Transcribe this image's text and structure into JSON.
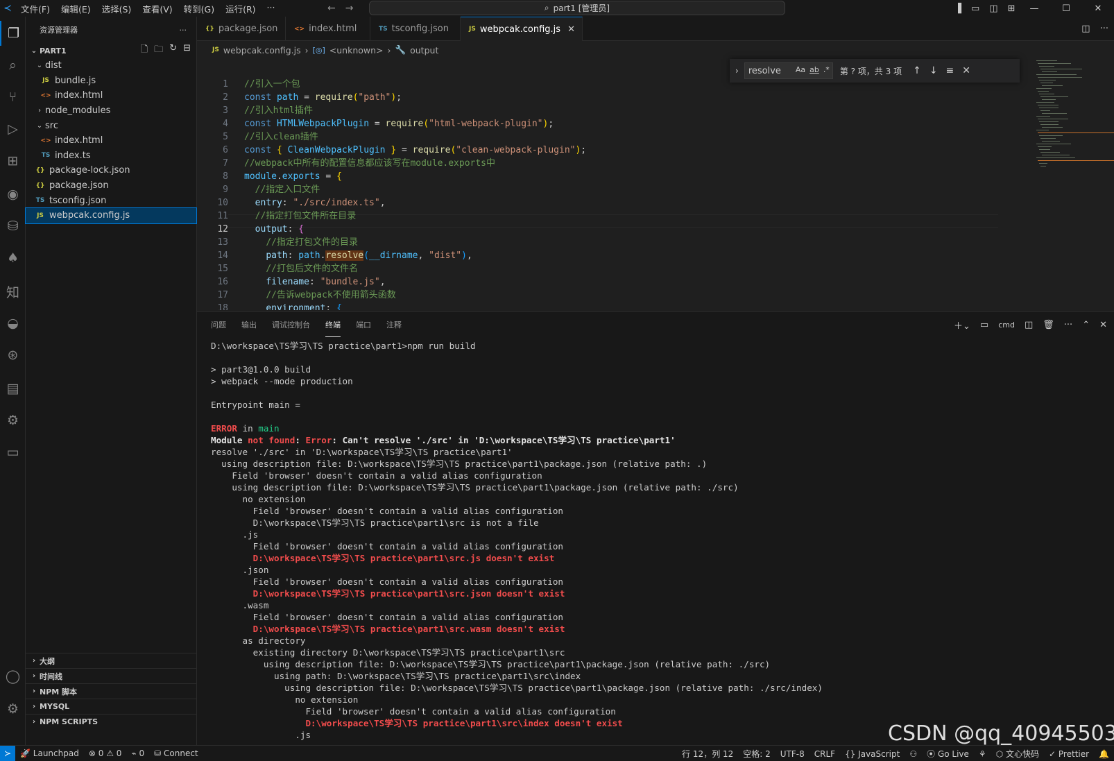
{
  "titlebar": {
    "menus": [
      "文件(F)",
      "编辑(E)",
      "选择(S)",
      "查看(V)",
      "转到(G)",
      "运行(R)",
      "···"
    ],
    "search_text": "part1 [管理员]"
  },
  "sidebar": {
    "title": "资源管理器",
    "more": "···",
    "root": "PART1",
    "tree": [
      {
        "label": "dist",
        "kind": "folder",
        "open": true,
        "depth": 1
      },
      {
        "label": "bundle.js",
        "kind": "js",
        "icon": "JS",
        "depth": 2
      },
      {
        "label": "index.html",
        "kind": "html",
        "icon": "<>",
        "depth": 2
      },
      {
        "label": "node_modules",
        "kind": "folder",
        "open": false,
        "depth": 1
      },
      {
        "label": "src",
        "kind": "folder",
        "open": true,
        "depth": 1
      },
      {
        "label": "index.html",
        "kind": "html",
        "icon": "<>",
        "depth": 2
      },
      {
        "label": "index.ts",
        "kind": "ts",
        "icon": "TS",
        "depth": 2
      },
      {
        "label": "package-lock.json",
        "kind": "json",
        "icon": "{}",
        "depth": 1
      },
      {
        "label": "package.json",
        "kind": "json",
        "icon": "{}",
        "depth": 1
      },
      {
        "label": "tsconfig.json",
        "kind": "ts",
        "icon": "TS",
        "depth": 1
      },
      {
        "label": "webpcak.config.js",
        "kind": "js",
        "icon": "JS",
        "depth": 1,
        "selected": true
      }
    ],
    "sections": [
      "大纲",
      "时间线",
      "NPM 脚本",
      "MYSQL",
      "NPM SCRIPTS"
    ]
  },
  "tabs": [
    {
      "label": "package.json",
      "icon": "{}",
      "kind": "json"
    },
    {
      "label": "index.html",
      "icon": "<>",
      "kind": "html"
    },
    {
      "label": "tsconfig.json",
      "icon": "TS",
      "kind": "ts"
    },
    {
      "label": "webpcak.config.js",
      "icon": "JS",
      "kind": "js",
      "active": true
    }
  ],
  "breadcrumb": [
    "webpcak.config.js",
    "<unknown>",
    "output"
  ],
  "find": {
    "query": "resolve",
    "options": [
      "Aa",
      "ab",
      ".*"
    ],
    "count": "第 ? 项，共 3 项"
  },
  "editor": {
    "line_numbers": [
      "1",
      "2",
      "3",
      "4",
      "5",
      "6",
      "7",
      "8",
      "9",
      "10",
      "11",
      "12",
      "13",
      "14",
      "15",
      "16",
      "17",
      "18"
    ],
    "current_line": "12"
  },
  "panel": {
    "tabs": [
      "问题",
      "输出",
      "调试控制台",
      "终端",
      "端口",
      "注释"
    ],
    "active_tab": "终端",
    "terminal_name": "cmd"
  },
  "terminal": {
    "prompt": "D:\\workspace\\TS学习\\TS practice\\part1>npm run build",
    "lines": [
      "> part3@1.0.0 build",
      "> webpack --mode production",
      "Entrypoint main =",
      "resolve './src' in 'D:\\workspace\\TS学习\\TS practice\\part1'",
      "  using description file: D:\\workspace\\TS学习\\TS practice\\part1\\package.json (relative path: .)",
      "    Field 'browser' doesn't contain a valid alias configuration",
      "    using description file: D:\\workspace\\TS学习\\TS practice\\part1\\package.json (relative path: ./src)",
      "      no extension",
      "        Field 'browser' doesn't contain a valid alias configuration",
      "        D:\\workspace\\TS学习\\TS practice\\part1\\src is not a file",
      "      .js",
      "        Field 'browser' doesn't contain a valid alias configuration",
      "        D:\\workspace\\TS学习\\TS practice\\part1\\src.js doesn't exist",
      "      .json",
      "        Field 'browser' doesn't contain a valid alias configuration",
      "        D:\\workspace\\TS学习\\TS practice\\part1\\src.json doesn't exist",
      "      .wasm",
      "        Field 'browser' doesn't contain a valid alias configuration",
      "        D:\\workspace\\TS学习\\TS practice\\part1\\src.wasm doesn't exist",
      "      as directory",
      "        existing directory D:\\workspace\\TS学习\\TS practice\\part1\\src",
      "          using description file: D:\\workspace\\TS学习\\TS practice\\part1\\package.json (relative path: ./src)",
      "            using path: D:\\workspace\\TS学习\\TS practice\\part1\\src\\index",
      "              using description file: D:\\workspace\\TS学习\\TS practice\\part1\\package.json (relative path: ./src/index)",
      "                no extension",
      "                  Field 'browser' doesn't contain a valid alias configuration",
      "                  D:\\workspace\\TS学习\\TS practice\\part1\\src\\index doesn't exist",
      "                .js"
    ],
    "error_word": "ERROR",
    "error_in": " in ",
    "error_main": "main",
    "module_word": "Module ",
    "not_found": "not found",
    "colon": ": ",
    "error_label": "Error",
    "error_msg": ": Can't resolve './src' in 'D:\\workspace\\TS学习\\TS practice\\part1'"
  },
  "statusbar": {
    "launchpad": "Launchpad",
    "errors": "0",
    "warnings": "0",
    "ports": "0",
    "connect": "Connect",
    "position": "行 12，列 12",
    "spaces": "空格: 2",
    "encoding": "UTF-8",
    "eol": "CRLF",
    "language": "JavaScript",
    "golive": "Go Live",
    "wenxin": "文心快码",
    "prettier": "Prettier"
  },
  "watermark": "CSDN @qq_40945503",
  "colors": {
    "accent": "#0078d4",
    "error": "#f14c4c",
    "success": "#23d18b",
    "warning": "#f5f543"
  }
}
